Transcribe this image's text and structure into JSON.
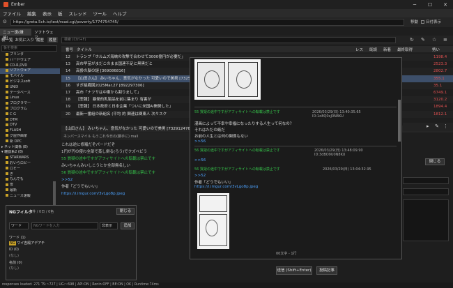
{
  "window": {
    "title": "Ember"
  },
  "menu": [
    "ファイル",
    "編集",
    "表示",
    "板",
    "スレッド",
    "ツール",
    "ヘルプ"
  ],
  "urlbar": {
    "url": "https://greta.5ch.io/test/read.cgi/poverty/1774754745/",
    "go_label": "移動",
    "auto_label": "日付表示"
  },
  "left_tabs": [
    "ニュー速(嫌儲)",
    "ソフトウェア"
  ],
  "left_toolbar": [
    "板一覧",
    "お気に入り",
    "履歴",
    "履歴"
  ],
  "left_search_placeholder": "板を検索",
  "tree": [
    {
      "label": "プリンタ",
      "cat": false
    },
    {
      "label": "ハードウェア",
      "cat": false
    },
    {
      "label": "CD-R,DVD",
      "cat": false
    },
    {
      "label": "ソフトウェア",
      "cat": false,
      "selected": true
    },
    {
      "label": "モバイル",
      "cat": false
    },
    {
      "label": "ビジネスsoft",
      "cat": false
    },
    {
      "label": "UNIX",
      "cat": false
    },
    {
      "label": "データベース",
      "cat": false
    },
    {
      "label": "Linux",
      "cat": false
    },
    {
      "label": "プログラマー",
      "cat": false
    },
    {
      "label": "プログラム",
      "cat": false
    },
    {
      "label": "C G",
      "cat": false
    },
    {
      "label": "DTM",
      "cat": false
    },
    {
      "label": "DTV",
      "cat": false
    },
    {
      "label": "FLASH",
      "cat": false
    },
    {
      "label": "グ屋作曲家",
      "cat": false
    },
    {
      "label": "新 DPC",
      "cat": false
    },
    {
      "label": "▸ ネット関係 (8)",
      "cat": true
    },
    {
      "label": "▾ 雑談系2 (8)",
      "cat": true
    },
    {
      "label": "STARWARS",
      "cat": false
    },
    {
      "label": "おいらロビー",
      "cat": false
    },
    {
      "label": "ロビー",
      "cat": false
    },
    {
      "label": "ぎ",
      "cat": false
    },
    {
      "label": "なんでも",
      "cat": false
    },
    {
      "label": "雪",
      "cat": false
    },
    {
      "label": "最新",
      "cat": false
    },
    {
      "label": "ニュース速報",
      "cat": false
    }
  ],
  "thread_header": {
    "cols": [
      "番号",
      "タイトル",
      "レス",
      "既読",
      "新着",
      "最終取得",
      "勢い"
    ],
    "search_placeholder": "検索 (Ctrl+F)"
  },
  "threads": [
    {
      "no": "12",
      "title": "トランプ「ホルムズ海峡の攻撃で合わせて3000億円が必要だ」",
      "val": "1198.4"
    },
    {
      "no": "13",
      "title": "高市早苗がまだこのまま国連不足に黒黒だと",
      "val": "2523.3"
    },
    {
      "no": "14",
      "title": "高齢の脳の謎 [369086816]",
      "val": "2802.7"
    },
    {
      "no": "15",
      "title": "【山田さん】 みいちゃん、意気がなかった 可愛いので美男 [7325",
      "val": "355.1",
      "selected": true
    },
    {
      "no": "16",
      "title": "すぎ組織図2025Mar.27 [892297306]",
      "val": "35.1"
    },
    {
      "no": "17",
      "title": "高市「ナフサは中東から割りまして」",
      "val": "6749.1"
    },
    {
      "no": "18",
      "title": "【悲報】 暴発的乳製品を前に集まり 有害が",
      "val": "3120.2"
    },
    {
      "no": "19",
      "title": "【悲報】 日本政府と日本企業「ついに米国AI開発した」",
      "val": "1894.4"
    },
    {
      "no": "20",
      "title": "最新一番組の新組名 (平均 約 関連は関東人 次々スク",
      "val": "1812.1"
    }
  ],
  "tab_title": "【山田さん】 みいちゃん、意気がなかった 可愛いので美男 [732912476] [1774754745]",
  "posts": [
    {
      "text": "これは逆に修羅だぞパードだぞ",
      "cls": ""
    },
    {
      "text": "1円が円の使わ全部で蒸し倒る(ろう)でクズベビう",
      "cls": ""
    },
    {
      "text": "55 質疑の途中ですがアフィサイトへの転載は禁止です",
      "cls": "grn"
    },
    {
      "text": "みいちゃんみいしこうとか全部無名しい",
      "cls": ""
    },
    {
      "text": "56 質疑の途中ですがアフィサイトへの転載は禁止です",
      "cls": "grn"
    },
    {
      "text": ">>52",
      "cls": "lnk"
    },
    {
      "text": "作者「どうでもいい」",
      "cls": ""
    },
    {
      "text": "https://i.imgur.com/3vLgo8p.jpeg",
      "cls": "lnk"
    }
  ],
  "popup_right": {
    "p1_head": "55 質疑の途中ですがアフィサイトへの転載は禁止です",
    "p1_date": "2026/03/29(日) 13:40:35.65",
    "p1_id": "ID:1o8Q0xJ0N8KU",
    "p1_lines": [
      "漫画によって不幸や幸福になったりする人生って何なの？",
      "それはただの紙だ",
      "お前の人生とは何の関係もない"
    ],
    "p1_link": ">>56",
    "p2_head": "56 質疑の途中ですがアフィサイトへの転載は禁止です",
    "p2_date": "2026/03/29(日) 13:48:09.90",
    "p2_id": "ID:3dBO9U0N8KU",
    "p3_head": "56 質疑の途中ですがアフィサイトへの転載は禁止です",
    "p3_date": "2026/03/29(日) 13:04:32.95",
    "p3_id": "ID:X1m7++C0M8KU",
    "p3_link": ">>52",
    "p3_author": "作者「どうでもいい」",
    "p3_url": "https://i.imgur.com/3vLgo8p.jpeg"
  },
  "ng": {
    "title": "NGフィルタ",
    "count": "1件 / 0日 / 0色",
    "close": "閉じる",
    "type": "ワード",
    "placeholder": "NGワードを入力",
    "mode": "非表示",
    "add": "追加",
    "list_header": "ワード (1)",
    "items": [
      "ワイ吉殿アデアチ"
    ],
    "group2": "ID (0)",
    "none": "(なし)",
    "group3": "名前 (0)",
    "none2": "(なし)"
  },
  "reply": {
    "hint": "00文字 - 1行",
    "send": "送信 (Shift+Enter)",
    "clear": "投稿記事",
    "close": "閉じる"
  },
  "status": "responses loaded: 271                                                                       TS:~727 | UG:~698 | API:ON | Ronin:OFF | BE:ON | OK | Runtime:74ms"
}
